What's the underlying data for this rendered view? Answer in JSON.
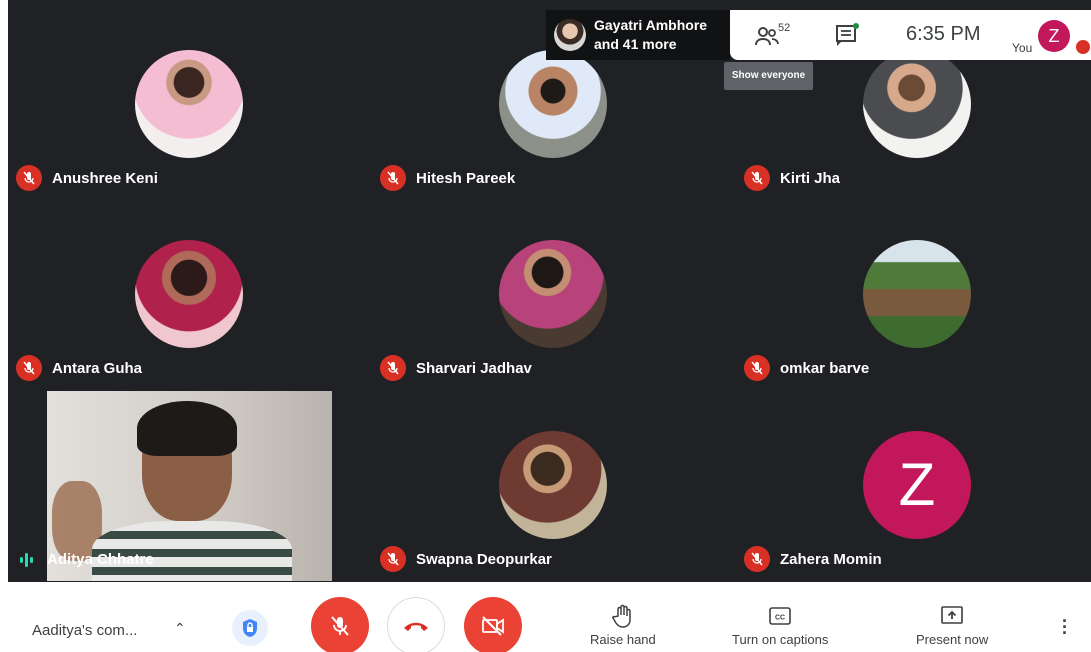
{
  "presenter": {
    "line1": "Gayatri Ambhore",
    "line2": "and 41 more"
  },
  "topbar": {
    "participant_count": "52",
    "time": "6:35 PM",
    "you_label": "You",
    "avatar_letter": "Z",
    "tooltip": "Show everyone"
  },
  "tiles": [
    {
      "name": "Anushree Keni"
    },
    {
      "name": "Hitesh Pareek"
    },
    {
      "name": "Kirti Jha"
    },
    {
      "name": "Antara Guha"
    },
    {
      "name": "Sharvari Jadhav"
    },
    {
      "name": "omkar barve"
    },
    {
      "name": "Aditya Chhatre"
    },
    {
      "name": "Swapna Deopurkar"
    },
    {
      "name": "Zahera Momin",
      "letter": "Z"
    }
  ],
  "bottombar": {
    "meeting_title": "Aaditya's com...",
    "raise_hand": "Raise hand",
    "captions": "Turn on captions",
    "present": "Present now"
  },
  "colors": {
    "mute_red": "#d93025",
    "avatar_pink": "#c2185b",
    "stage_bg": "#202124"
  }
}
